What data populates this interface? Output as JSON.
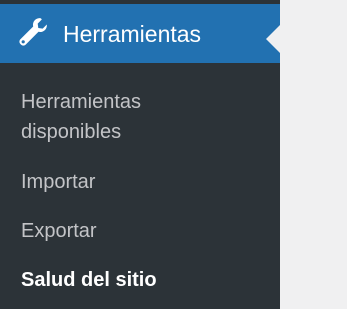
{
  "menu": {
    "title": "Herramientas",
    "icon": "wrench-icon",
    "accent_color": "#2271b1",
    "background_color": "#2c3338",
    "submenu": [
      {
        "label": "Herramientas disponibles",
        "current": false
      },
      {
        "label": "Importar",
        "current": false
      },
      {
        "label": "Exportar",
        "current": false
      },
      {
        "label": "Salud del sitio",
        "current": true
      }
    ]
  }
}
